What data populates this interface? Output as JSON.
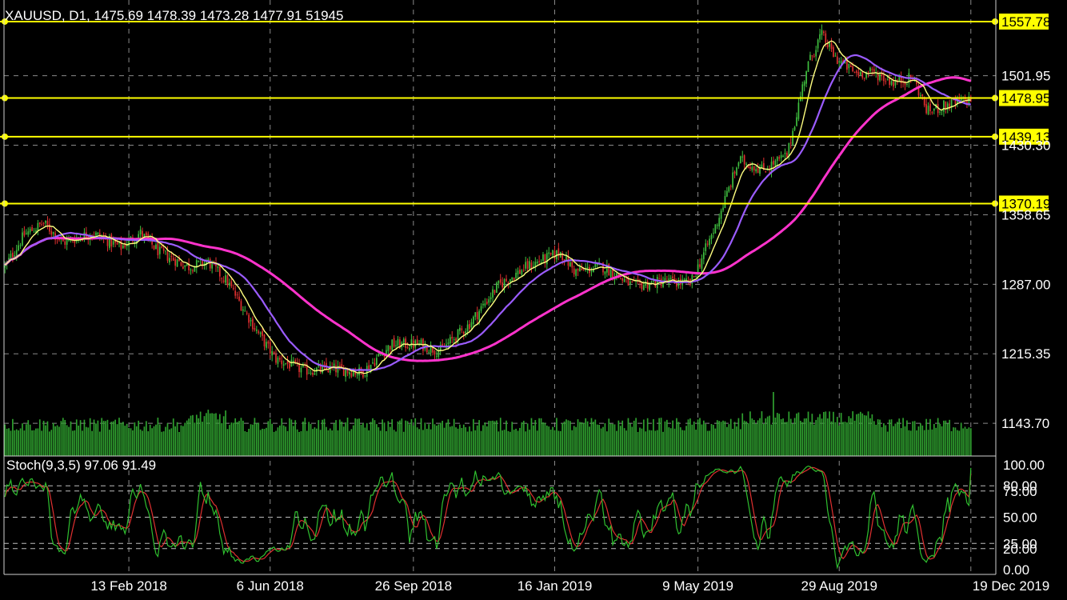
{
  "chart_data": [
    {
      "type": "candlestick",
      "header": "XAUUSD, D1, 1475.69 1478.39 1473.28 1477.91 51945",
      "symbol": "XAUUSD",
      "timeframe": "D1",
      "ohlc_last": {
        "open": 1475.69,
        "high": 1478.39,
        "low": 1473.28,
        "close": 1477.91,
        "volume": 51945
      },
      "ylim": [
        1110,
        1580
      ],
      "y_ticks": [
        "1501.95",
        "1430.30",
        "1358.65",
        "1287.00",
        "1215.35",
        "1143.70"
      ],
      "x_ticks": [
        "13 Feb 2018",
        "6 Jun 2018",
        "26 Sep 2018",
        "16 Jan 2019",
        "9 May 2019",
        "29 Aug 2019",
        "19 Dec 2019"
      ],
      "grid": true,
      "horizontal_levels": [
        {
          "label": "1557.78",
          "value": 1557.78,
          "color": "#ffff00"
        },
        {
          "label": "1478.95",
          "value": 1478.95,
          "color": "#ffff00"
        },
        {
          "label": "1439.13",
          "value": 1439.13,
          "color": "#ffff00"
        },
        {
          "label": "1370.19",
          "value": 1370.19,
          "color": "#ffff00"
        }
      ],
      "price_path": [
        {
          "t": 0.0,
          "price": 1305
        },
        {
          "t": 0.02,
          "price": 1338
        },
        {
          "t": 0.04,
          "price": 1350
        },
        {
          "t": 0.06,
          "price": 1330
        },
        {
          "t": 0.09,
          "price": 1340
        },
        {
          "t": 0.12,
          "price": 1325
        },
        {
          "t": 0.14,
          "price": 1340
        },
        {
          "t": 0.16,
          "price": 1320
        },
        {
          "t": 0.19,
          "price": 1305
        },
        {
          "t": 0.21,
          "price": 1310
        },
        {
          "t": 0.23,
          "price": 1290
        },
        {
          "t": 0.26,
          "price": 1240
        },
        {
          "t": 0.28,
          "price": 1210
        },
        {
          "t": 0.31,
          "price": 1198
        },
        {
          "t": 0.34,
          "price": 1200
        },
        {
          "t": 0.37,
          "price": 1196
        },
        {
          "t": 0.4,
          "price": 1225
        },
        {
          "t": 0.43,
          "price": 1225
        },
        {
          "t": 0.45,
          "price": 1218
        },
        {
          "t": 0.48,
          "price": 1245
        },
        {
          "t": 0.51,
          "price": 1285
        },
        {
          "t": 0.54,
          "price": 1305
        },
        {
          "t": 0.575,
          "price": 1320
        },
        {
          "t": 0.59,
          "price": 1300
        },
        {
          "t": 0.62,
          "price": 1305
        },
        {
          "t": 0.65,
          "price": 1285
        },
        {
          "t": 0.68,
          "price": 1290
        },
        {
          "t": 0.71,
          "price": 1288
        },
        {
          "t": 0.735,
          "price": 1345
        },
        {
          "t": 0.76,
          "price": 1415
        },
        {
          "t": 0.785,
          "price": 1405
        },
        {
          "t": 0.81,
          "price": 1420
        },
        {
          "t": 0.83,
          "price": 1510
        },
        {
          "t": 0.845,
          "price": 1545
        },
        {
          "t": 0.86,
          "price": 1520
        },
        {
          "t": 0.88,
          "price": 1505
        },
        {
          "t": 0.9,
          "price": 1505
        },
        {
          "t": 0.92,
          "price": 1495
        },
        {
          "t": 0.94,
          "price": 1500
        },
        {
          "t": 0.955,
          "price": 1465
        },
        {
          "t": 0.97,
          "price": 1470
        },
        {
          "t": 1.0,
          "price": 1478
        }
      ],
      "ma_fast_color": "#ffff80",
      "ma_mid_color": "#9b5cff",
      "ma_slow_color": "#ff33cc",
      "candle_up_color": "#3fbf3f",
      "candle_down_color": "#e03030",
      "volume_color": "#2fa02f"
    },
    {
      "type": "line",
      "indicator": "Stoch(9,3,5) 97.06 91.49",
      "values_last": [
        97.06,
        91.49
      ],
      "ylim": [
        0,
        100
      ],
      "y_ticks": [
        "100.00",
        "80.00",
        "75.00",
        "50.00",
        "25.00",
        "20.00",
        "0.00"
      ],
      "levels": [
        80,
        75,
        50,
        25,
        20
      ],
      "main_color": "#2fbf2f",
      "signal_color": "#e03030"
    }
  ]
}
